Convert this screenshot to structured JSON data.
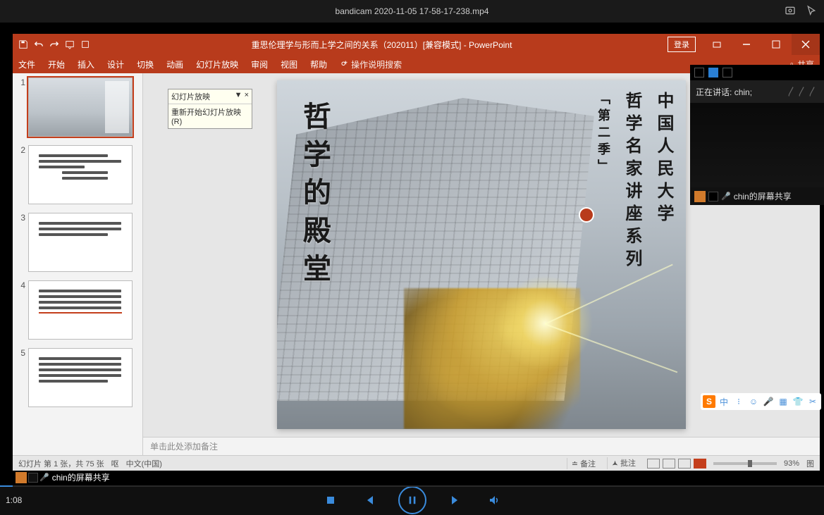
{
  "titlebar": {
    "title": "bandicam 2020-11-05 17-58-17-238.mp4"
  },
  "powerpoint": {
    "title": "重思伦理学与形而上学之间的关系（202011）[兼容模式] - PowerPoint",
    "login": "登录",
    "ribbon": {
      "file": "文件",
      "home": "开始",
      "insert": "插入",
      "design": "设计",
      "transitions": "切换",
      "animations": "动画",
      "slideshow": "幻灯片放映",
      "review": "审阅",
      "view": "视图",
      "help": "帮助",
      "search": "操作说明搜索",
      "share": "共享"
    },
    "tip": {
      "head": "幻灯片放映",
      "pin": "▼",
      "close": "×",
      "body": "重新开始幻灯片放映(R)"
    },
    "slide_text": {
      "main": "哲学的殿堂",
      "col1": "中国人民大学",
      "col2": "哲学名家讲座系列",
      "col3": "「第二季」"
    },
    "notes": "单击此处添加备注",
    "status": {
      "slide_info": "幻灯片 第 1 张，共 75 张",
      "lang_icon": "呕",
      "lang": "中文(中国)",
      "notes_btn": "备注",
      "comments_btn": "批注",
      "zoom": "93%",
      "fit": "图"
    },
    "thumbs": [
      "1",
      "2",
      "3",
      "4",
      "5"
    ]
  },
  "zoom": {
    "speaking_label": "正在讲话:",
    "speaker": "chin;",
    "share_text": "chin的屏幕共享"
  },
  "share_badge": {
    "text": "chin的屏幕共享"
  },
  "ime": {
    "logo": "S",
    "i1": "中",
    "i2": "⁝",
    "i3": "☺",
    "i4": "🎤",
    "i5": "▦",
    "i6": "👕",
    "i7": "✂"
  },
  "player": {
    "time": "1:08"
  }
}
